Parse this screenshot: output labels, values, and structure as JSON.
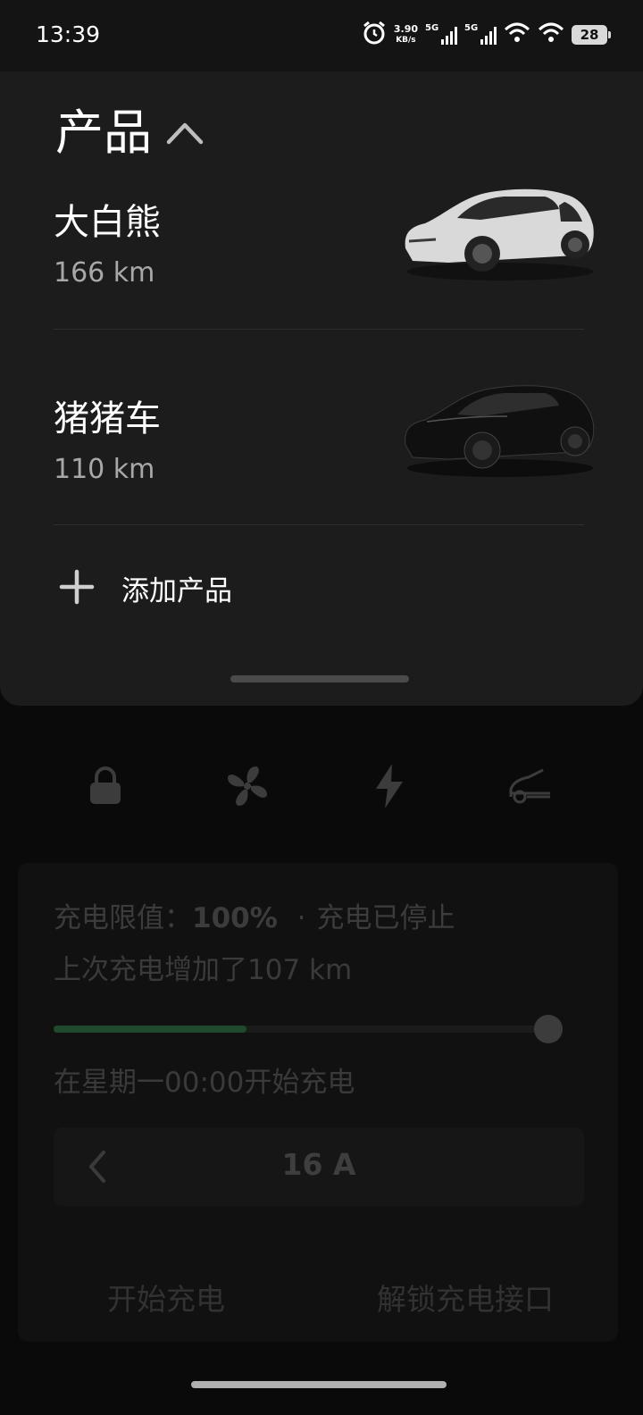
{
  "status_bar": {
    "time": "13:39",
    "net_speed_value": "3.90",
    "net_speed_unit": "KB/s",
    "signal1_label": "5G",
    "signal2_label": "5G",
    "battery": "28"
  },
  "products_sheet": {
    "title": "产品",
    "vehicles": [
      {
        "name": "大白熊",
        "range": "166 km",
        "color": "white"
      },
      {
        "name": "猪猪车",
        "range": "110 km",
        "color": "black"
      }
    ],
    "add_label": "添加产品"
  },
  "quick_controls": [
    "lock-icon",
    "fan-icon",
    "bolt-icon",
    "car-frunk-icon"
  ],
  "charging": {
    "limit_label": "充电限值：",
    "limit_value": "100%",
    "separator": "·",
    "state": "充电已停止",
    "last_charge": "上次充电增加了107 km",
    "battery_fill_fraction": 0.39,
    "schedule": "在星期一00:00开始充电",
    "amperage": "16 A",
    "start_button": "开始充电",
    "unlock_button": "解锁充电接口",
    "fill_color": "#1f4a2e"
  }
}
